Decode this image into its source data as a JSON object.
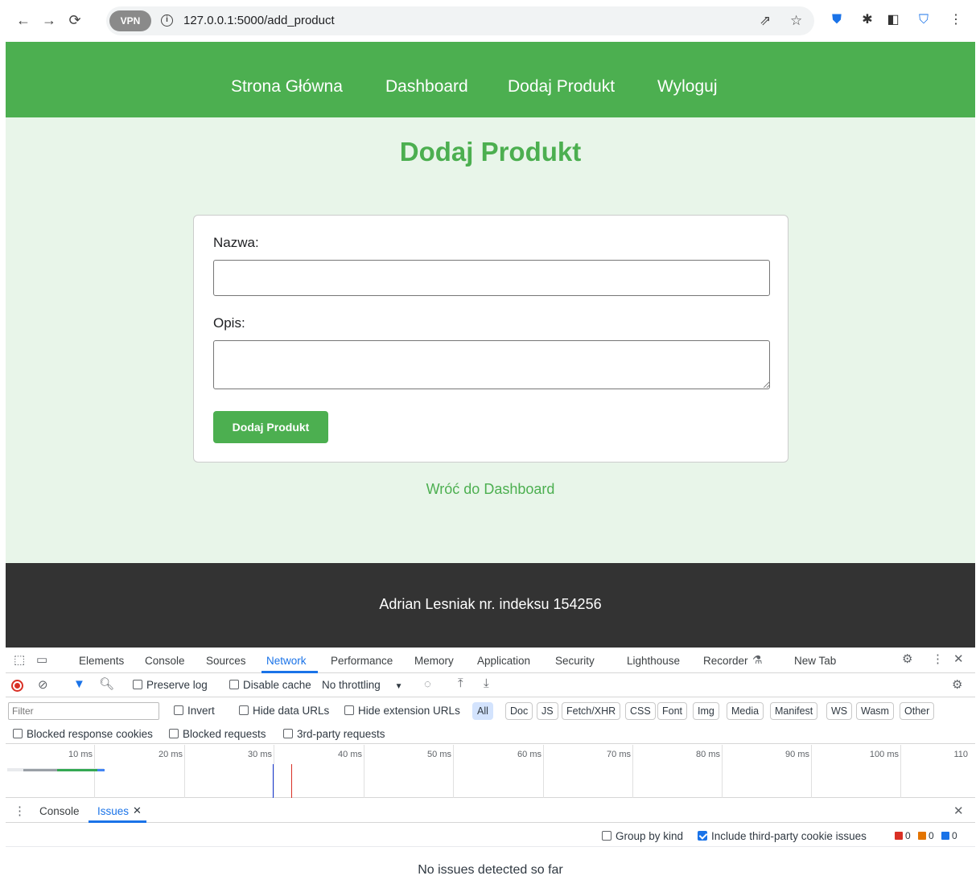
{
  "browser": {
    "url": "127.0.0.1:5000/add_product",
    "vpn_label": "VPN",
    "icons": [
      "back-arrow-icon",
      "forward-arrow-icon",
      "reload-icon",
      "info-icon",
      "share-icon",
      "star-icon",
      "shield-extension-icon",
      "puzzle-extension-icon",
      "side-panel-icon",
      "shield-check-icon",
      "more-vert-icon"
    ]
  },
  "site": {
    "nav": [
      "Strona Główna",
      "Dashboard",
      "Dodaj Produkt",
      "Wyloguj"
    ],
    "title": "Dodaj Produkt",
    "form": {
      "name_label": "Nazwa:",
      "name_value": "",
      "desc_label": "Opis:",
      "desc_value": "",
      "submit_label": "Dodaj Produkt"
    },
    "back_link": "Wróć do Dashboard",
    "footer": "Adrian Lesniak nr. indeksu 154256",
    "colors": {
      "accent": "#4caf50",
      "page_bg": "#e8f5e9",
      "footer_bg": "#333333"
    }
  },
  "devtools": {
    "tabs": [
      "Elements",
      "Console",
      "Sources",
      "Network",
      "Performance",
      "Memory",
      "Application",
      "Security",
      "Lighthouse",
      "Recorder",
      "New Tab"
    ],
    "active_tab": "Network",
    "toolbar": {
      "preserve_log": "Preserve log",
      "disable_cache": "Disable cache",
      "throttling": "No throttling"
    },
    "filter": {
      "placeholder": "Filter",
      "invert": "Invert",
      "hide_data_urls": "Hide data URLs",
      "hide_extension_urls": "Hide extension URLs",
      "types": [
        "All",
        "Doc",
        "JS",
        "Fetch/XHR",
        "CSS",
        "Font",
        "Img",
        "Media",
        "Manifest",
        "WS",
        "Wasm",
        "Other"
      ]
    },
    "extra_filters": [
      "Blocked response cookies",
      "Blocked requests",
      "3rd-party requests"
    ],
    "timeline_ticks": [
      "10 ms",
      "20 ms",
      "30 ms",
      "40 ms",
      "50 ms",
      "60 ms",
      "70 ms",
      "80 ms",
      "90 ms",
      "100 ms",
      "110"
    ],
    "drawer": {
      "tabs": [
        "Console",
        "Issues"
      ],
      "active_tab": "Issues",
      "group_by_kind": "Group by kind",
      "include_third_party": "Include third-party cookie issues",
      "counts": {
        "errors": "0",
        "warnings": "0",
        "info": "0"
      },
      "message": "No issues detected so far"
    }
  }
}
